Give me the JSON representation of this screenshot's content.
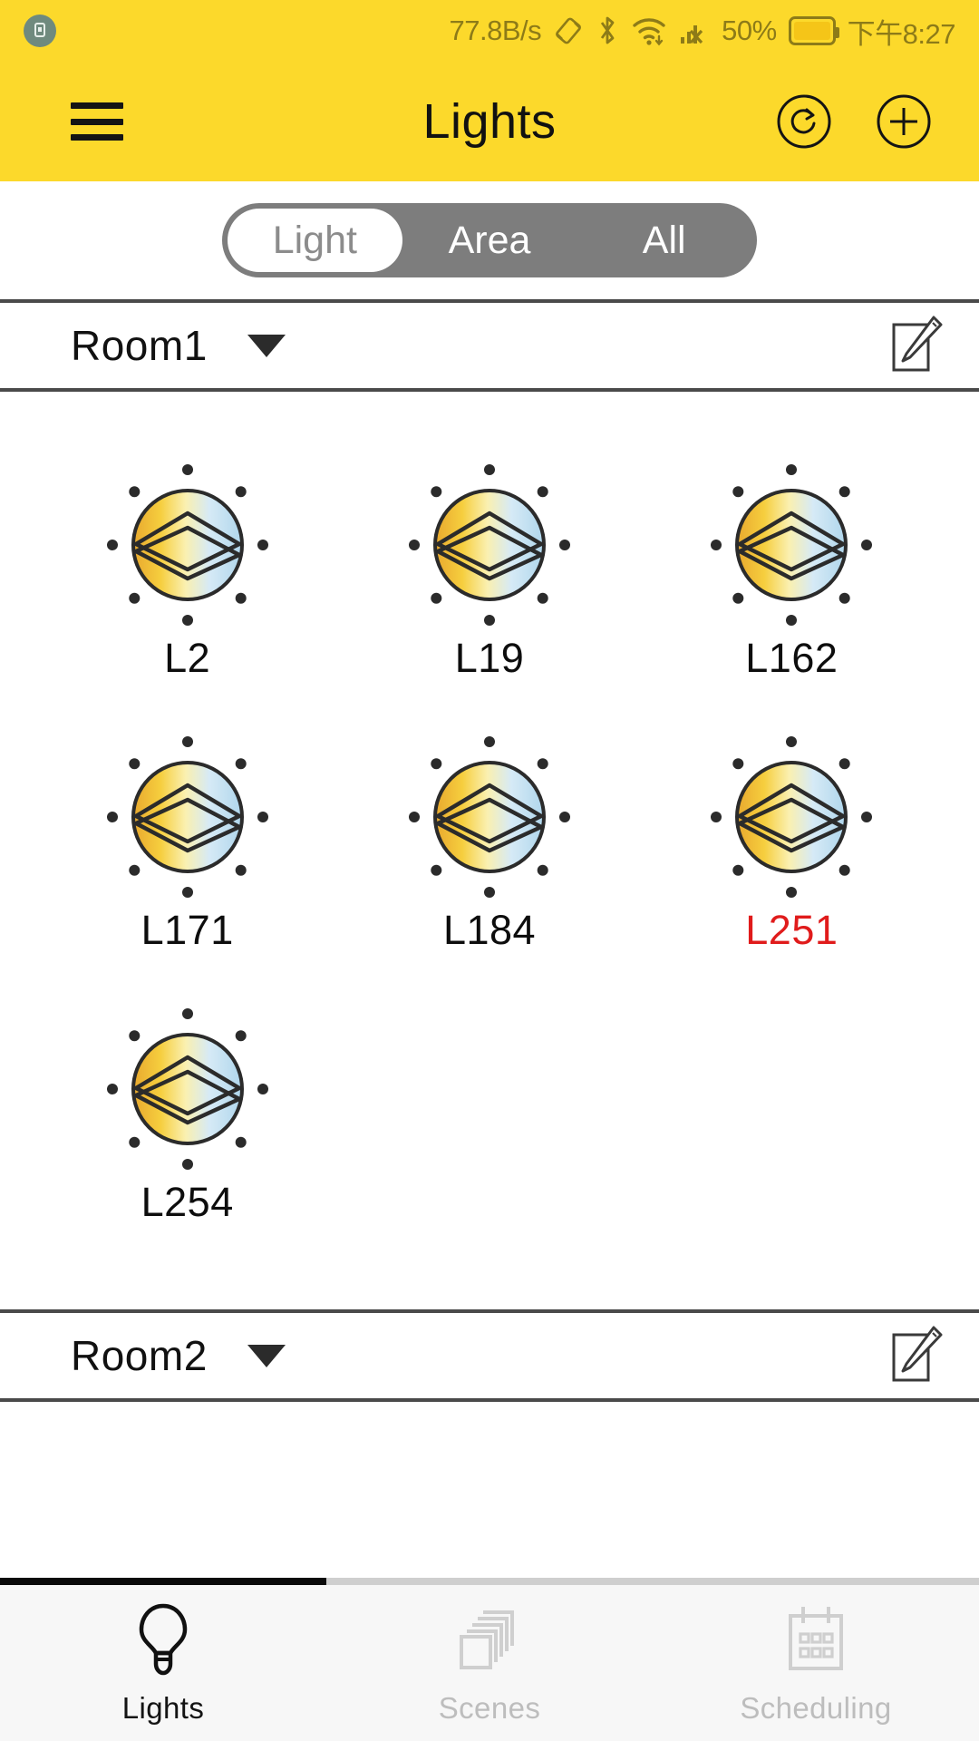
{
  "status_bar": {
    "usb_icon": "usb-debug-icon",
    "network_speed": "77.8B/s",
    "icons": [
      "vibrate-icon",
      "bluetooth-icon",
      "wifi-icon",
      "signal-off-icon"
    ],
    "battery_percent": "50%",
    "battery_icon": "battery-icon",
    "time": "下午8:27"
  },
  "app_bar": {
    "menu_icon": "hamburger-menu-icon",
    "title": "Lights",
    "refresh_icon": "refresh-icon",
    "add_icon": "add-icon"
  },
  "segmented_control": {
    "selected": "Light",
    "options": [
      {
        "label": "Light",
        "active": true
      },
      {
        "label": "Area",
        "active": false
      },
      {
        "label": "All",
        "active": false
      }
    ]
  },
  "rooms": [
    {
      "name": "Room1",
      "caret_icon": "chevron-down-icon",
      "edit_icon": "edit-pencil-icon",
      "lights": [
        {
          "label": "L2",
          "state": "normal"
        },
        {
          "label": "L19",
          "state": "normal"
        },
        {
          "label": "L162",
          "state": "normal"
        },
        {
          "label": "L171",
          "state": "normal"
        },
        {
          "label": "L184",
          "state": "normal"
        },
        {
          "label": "L251",
          "state": "alert"
        },
        {
          "label": "L254",
          "state": "normal"
        }
      ]
    },
    {
      "name": "Room2",
      "caret_icon": "chevron-down-icon",
      "edit_icon": "edit-pencil-icon",
      "lights": []
    }
  ],
  "bottom_nav": {
    "items": [
      {
        "label": "Lights",
        "icon": "lightbulb-icon",
        "active": true
      },
      {
        "label": "Scenes",
        "icon": "stacked-cards-icon",
        "active": false
      },
      {
        "label": "Scheduling",
        "icon": "calendar-icon",
        "active": false
      }
    ]
  },
  "colors": {
    "header_yellow": "#FCD92B",
    "status_text": "#8d7b18",
    "segment_gray": "#7d7d7d",
    "alert_red": "#E01B1B",
    "light_gold": "#F2C230",
    "light_blue": "#BBDDEE",
    "nav_inactive": "#bdbdbd"
  }
}
